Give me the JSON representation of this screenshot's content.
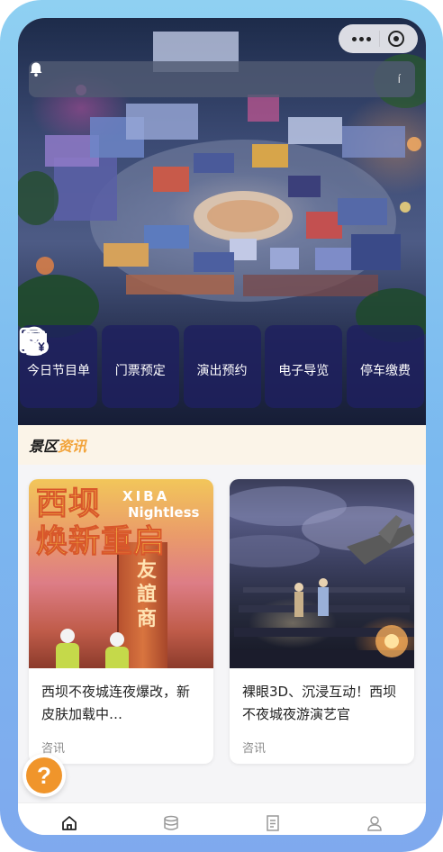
{
  "capsule": {
    "more_icon": "more-dots-icon",
    "close_icon": "record-circle-icon"
  },
  "notice": {
    "icon": "bell-icon",
    "text": "",
    "trailing": "í"
  },
  "quick_menu": [
    {
      "label": "今日节目单",
      "icon": "magic-hat-icon"
    },
    {
      "label": "门票预定",
      "icon": "ticket-icon"
    },
    {
      "label": "演出预约",
      "icon": "sofa-icon"
    },
    {
      "label": "电子导览",
      "icon": "location-pin-icon"
    },
    {
      "label": "停车缴费",
      "icon": "parking-payment-icon"
    }
  ],
  "news": {
    "heading_part1": "景区",
    "heading_part2": "资讯",
    "cards": [
      {
        "image_text_line1": "西坝",
        "image_text_line2": "焕新重启",
        "image_en_line1": "XIBA",
        "image_en_line2": "Nightless",
        "image_sign": "友誼商",
        "title": "西坝不夜城连夜爆改，新皮肤加载中…",
        "tag": "咨讯"
      },
      {
        "title": "裸眼3D、沉浸互动！西坝不夜城夜游演艺官",
        "tag": "咨讯"
      }
    ]
  },
  "help_button": {
    "label": "?"
  },
  "tabbar": [
    {
      "icon": "home-icon",
      "active": true
    },
    {
      "icon": "database-icon",
      "active": false
    },
    {
      "icon": "document-icon",
      "active": false
    },
    {
      "icon": "user-icon",
      "active": false
    }
  ],
  "colors": {
    "frame": "#8fd0f2",
    "quick_bg": "#1e205f",
    "news_head_bg": "#fbf4e8",
    "accent_orange": "#f2a33a",
    "help_orange": "#f0952b"
  }
}
